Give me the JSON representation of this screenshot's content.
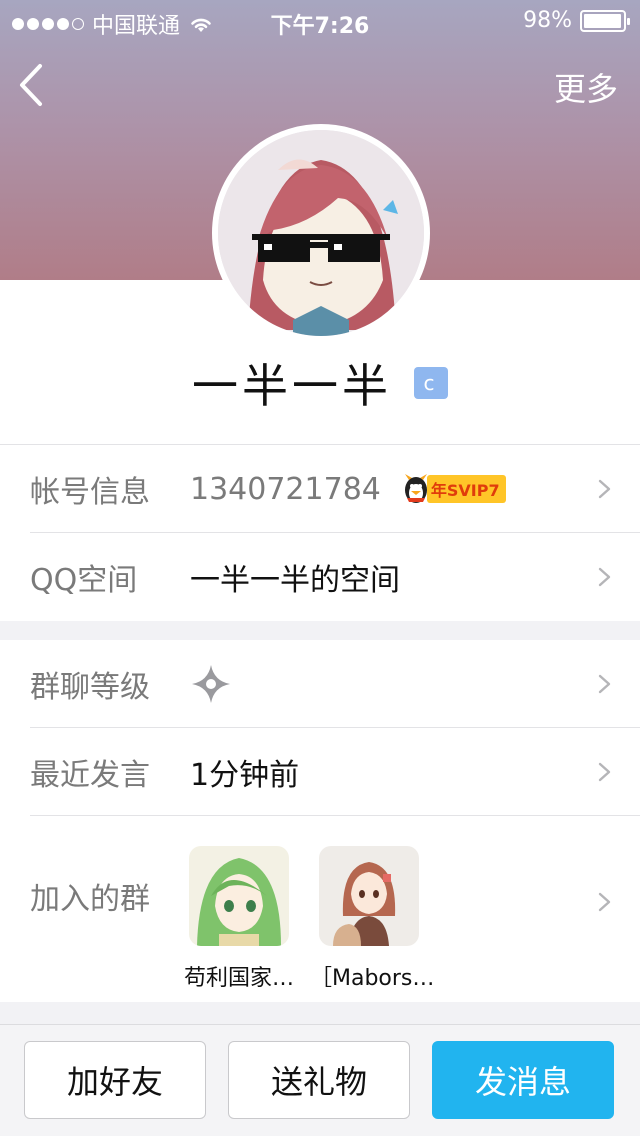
{
  "status": {
    "carrier": "中国联通",
    "time": "下午7:26",
    "battery": "98%",
    "battery_level": 0.98,
    "signal_dots": 5,
    "signal_filled": 4
  },
  "nav": {
    "more": "更多"
  },
  "profile": {
    "nickname": "一半一半",
    "badge": "c"
  },
  "info": {
    "account_label": "帐号信息",
    "account_value": "1340721784",
    "svip": "年SVIP7",
    "qzone_label": "QQ空间",
    "qzone_value": "一半一半的空间"
  },
  "group": {
    "level_label": "群聊等级",
    "recent_label": "最近发言",
    "recent_value": "1分钟前",
    "joined_label": "加入的群",
    "joined": [
      {
        "name": "苟利国家…"
      },
      {
        "name": "［Mabors…"
      }
    ]
  },
  "actions": {
    "add_friend": "加好友",
    "gift": "送礼物",
    "message": "发消息"
  },
  "colors": {
    "accent": "#21b4ef",
    "header_top": "#a7a6c0",
    "header_bottom": "#b07d88"
  }
}
